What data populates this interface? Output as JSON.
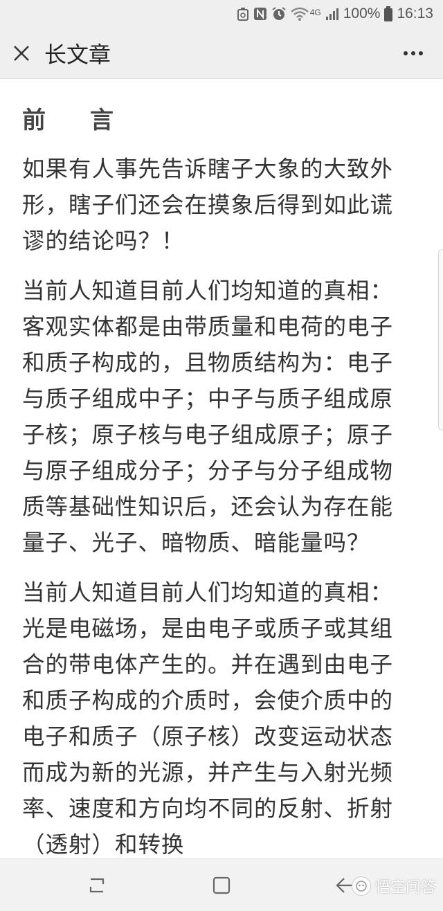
{
  "status_bar": {
    "network": "4G",
    "battery": "100%",
    "time": "16:13"
  },
  "header": {
    "title": "长文章",
    "close_icon": "close-icon",
    "more_icon": "more-icon"
  },
  "article": {
    "heading": "前言",
    "paragraphs": [
      "如果有人事先告诉瞎子大象的大致外形，瞎子们还会在摸象后得到如此谎谬的结论吗？！",
      "当前人知道目前人们均知道的真相：客观实体都是由带质量和电荷的电子和质子构成的，且物质结构为：电子与质子组成中子；中子与质子组成原子核；原子核与电子组成原子；原子与原子组成分子；分子与分子组成物质等基础性知识后，还会认为存在能量子、光子、暗物质、暗能量吗？",
      "当前人知道目前人们均知道的真相：光是电磁场，是由电子或质子或其组合的带电体产生的。并在遇到由电子和质子构成的介质时，会使介质中的电子和质子（原子核）改变运动状态而成为新的光源，并产生与入射光频率、速度和方向均不同的反射、折射（透射）和转换"
    ]
  },
  "nav_bar": {
    "recent_icon": "recent-apps-icon",
    "home_icon": "home-icon",
    "back_icon": "back-icon"
  },
  "watermark": {
    "text": "悟空问答"
  }
}
